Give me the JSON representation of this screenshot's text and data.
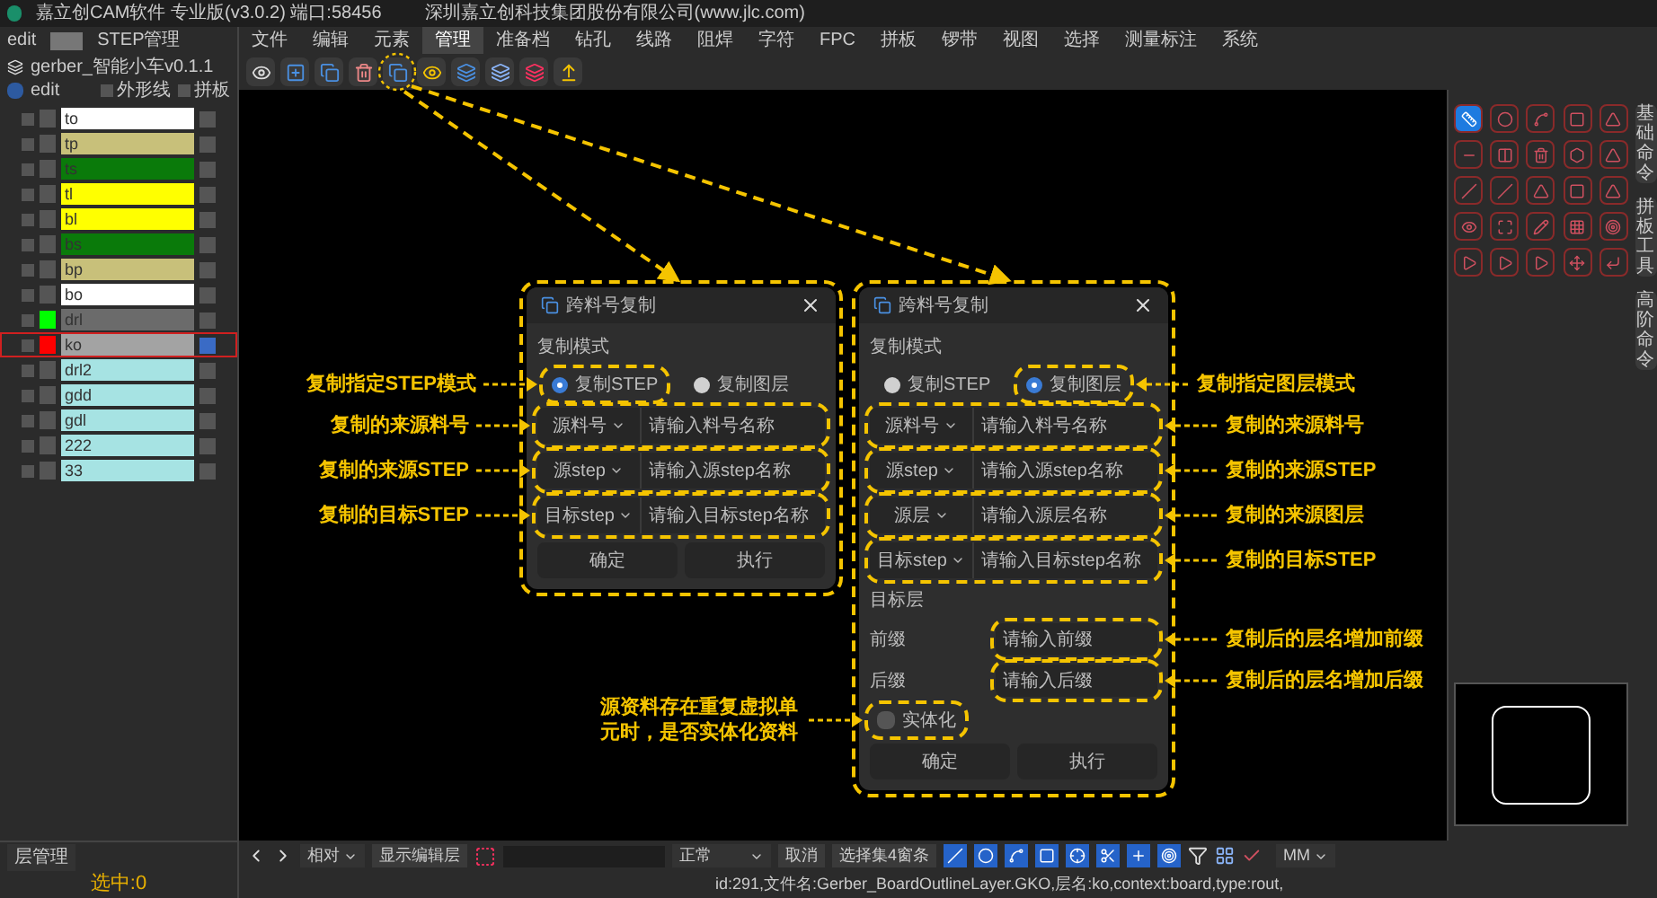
{
  "window": {
    "title": "嘉立创CAM软件 专业版(v3.0.2) 端口:58456",
    "company": "深圳嘉立创科技集团股份有限公司(www.jlc.com)"
  },
  "left_panel": {
    "job_label": "edit",
    "tab": "STEP管理",
    "job": "gerber_智能小车v0.1.1",
    "step": "edit",
    "options": [
      {
        "label": "外形线",
        "checked": false
      },
      {
        "label": "拼板",
        "checked": false
      }
    ],
    "layers": [
      {
        "name": "to",
        "color": "#ffffff",
        "displayed": false,
        "working": false,
        "selected": false
      },
      {
        "name": "tp",
        "color": "#c8c07a",
        "displayed": false,
        "working": false,
        "selected": false
      },
      {
        "name": "ts",
        "color": "#0a7a0a",
        "displayed": false,
        "working": false,
        "selected": false
      },
      {
        "name": "tl",
        "color": "#ffff00",
        "displayed": false,
        "working": false,
        "selected": false
      },
      {
        "name": "bl",
        "color": "#ffff00",
        "displayed": false,
        "working": false,
        "selected": false
      },
      {
        "name": "bs",
        "color": "#0a7a0a",
        "displayed": false,
        "working": false,
        "selected": false
      },
      {
        "name": "bp",
        "color": "#c8c07a",
        "displayed": false,
        "working": false,
        "selected": false
      },
      {
        "name": "bo",
        "color": "#ffffff",
        "displayed": false,
        "working": false,
        "selected": false
      },
      {
        "name": "drl",
        "color": "#6b6b6b",
        "displayed": true,
        "working": false,
        "selected": false
      },
      {
        "name": "ko",
        "color": "#a3a3a3",
        "displayed": false,
        "working": true,
        "selected": true
      },
      {
        "name": "drl2",
        "color": "#a6e3e3",
        "displayed": false,
        "working": false,
        "selected": false
      },
      {
        "name": "gdd",
        "color": "#a6e3e3",
        "displayed": false,
        "working": false,
        "selected": false
      },
      {
        "name": "gdl",
        "color": "#a6e3e3",
        "displayed": false,
        "working": false,
        "selected": false
      },
      {
        "name": "222",
        "color": "#a6e3e3",
        "displayed": false,
        "working": false,
        "selected": false
      },
      {
        "name": "33",
        "color": "#a6e3e3",
        "displayed": false,
        "working": false,
        "selected": false
      }
    ],
    "layer_manager": "层管理",
    "selection": "选中:0"
  },
  "menu": [
    {
      "label": "文件",
      "selected": false
    },
    {
      "label": "编辑",
      "selected": false
    },
    {
      "label": "元素",
      "selected": false
    },
    {
      "label": "管理",
      "selected": true
    },
    {
      "label": "准备档",
      "selected": false
    },
    {
      "label": "钻孔",
      "selected": false
    },
    {
      "label": "线路",
      "selected": false
    },
    {
      "label": "阻焊",
      "selected": false
    },
    {
      "label": "字符",
      "selected": false
    },
    {
      "label": "FPC",
      "selected": false
    },
    {
      "label": "拼板",
      "selected": false
    },
    {
      "label": "锣带",
      "selected": false
    },
    {
      "label": "视图",
      "selected": false
    },
    {
      "label": "选择",
      "selected": false
    },
    {
      "label": "测量标注",
      "selected": false
    },
    {
      "label": "系统",
      "selected": false
    }
  ],
  "dialogs": [
    {
      "title": "跨料号复制",
      "mode_label": "复制模式",
      "modes": [
        {
          "label": "复制STEP",
          "selected": true,
          "note": "复制指定STEP模式"
        },
        {
          "label": "复制图层",
          "selected": false
        }
      ],
      "fields": [
        {
          "dropdown": "源料号",
          "placeholder": "请输入料号名称",
          "note": "复制的来源料号"
        },
        {
          "dropdown": "源step",
          "placeholder": "请输入源step名称",
          "note": "复制的来源STEP"
        },
        {
          "dropdown": "目标step",
          "placeholder": "请输入目标step名称",
          "note": "复制的目标STEP"
        }
      ],
      "buttons": [
        "确定",
        "执行"
      ]
    },
    {
      "title": "跨料号复制",
      "mode_label": "复制模式",
      "modes": [
        {
          "label": "复制STEP",
          "selected": false
        },
        {
          "label": "复制图层",
          "selected": true,
          "note": "复制指定图层模式"
        }
      ],
      "fields": [
        {
          "dropdown": "源料号",
          "placeholder": "请输入料号名称",
          "note": "复制的来源料号"
        },
        {
          "dropdown": "源step",
          "placeholder": "请输入源step名称",
          "note": "复制的来源STEP"
        },
        {
          "dropdown": "源层",
          "placeholder": "请输入源层名称",
          "note": "复制的来源图层"
        },
        {
          "dropdown": "目标step",
          "placeholder": "请输入目标step名称",
          "note": "复制的目标STEP"
        }
      ],
      "target_layer": {
        "label": "目标层",
        "fields": [
          {
            "label": "前缀",
            "placeholder": "请输入前缀",
            "note": "复制后的层名增加前缀"
          },
          {
            "label": "后缀",
            "placeholder": "请输入后缀",
            "note": "复制后的层名增加后缀"
          }
        ]
      },
      "checkbox": {
        "label": "实体化",
        "checked": false,
        "note": "源资料存在重复虚拟单元时，是否实体化资料"
      },
      "buttons": [
        "确定",
        "执行"
      ]
    }
  ],
  "right_tabs": [
    "基础命令",
    "拼板工具",
    "高阶命令"
  ],
  "bottom_toolbar": {
    "mode": "相对",
    "show_edit": "显示编辑层",
    "filter": "正常",
    "cancel": "取消",
    "select": "选择集4窗条",
    "unit": "MM"
  },
  "status": "id:291,文件名:Gerber_BoardOutlineLayer.GKO,层名:ko,context:board,type:rout,"
}
